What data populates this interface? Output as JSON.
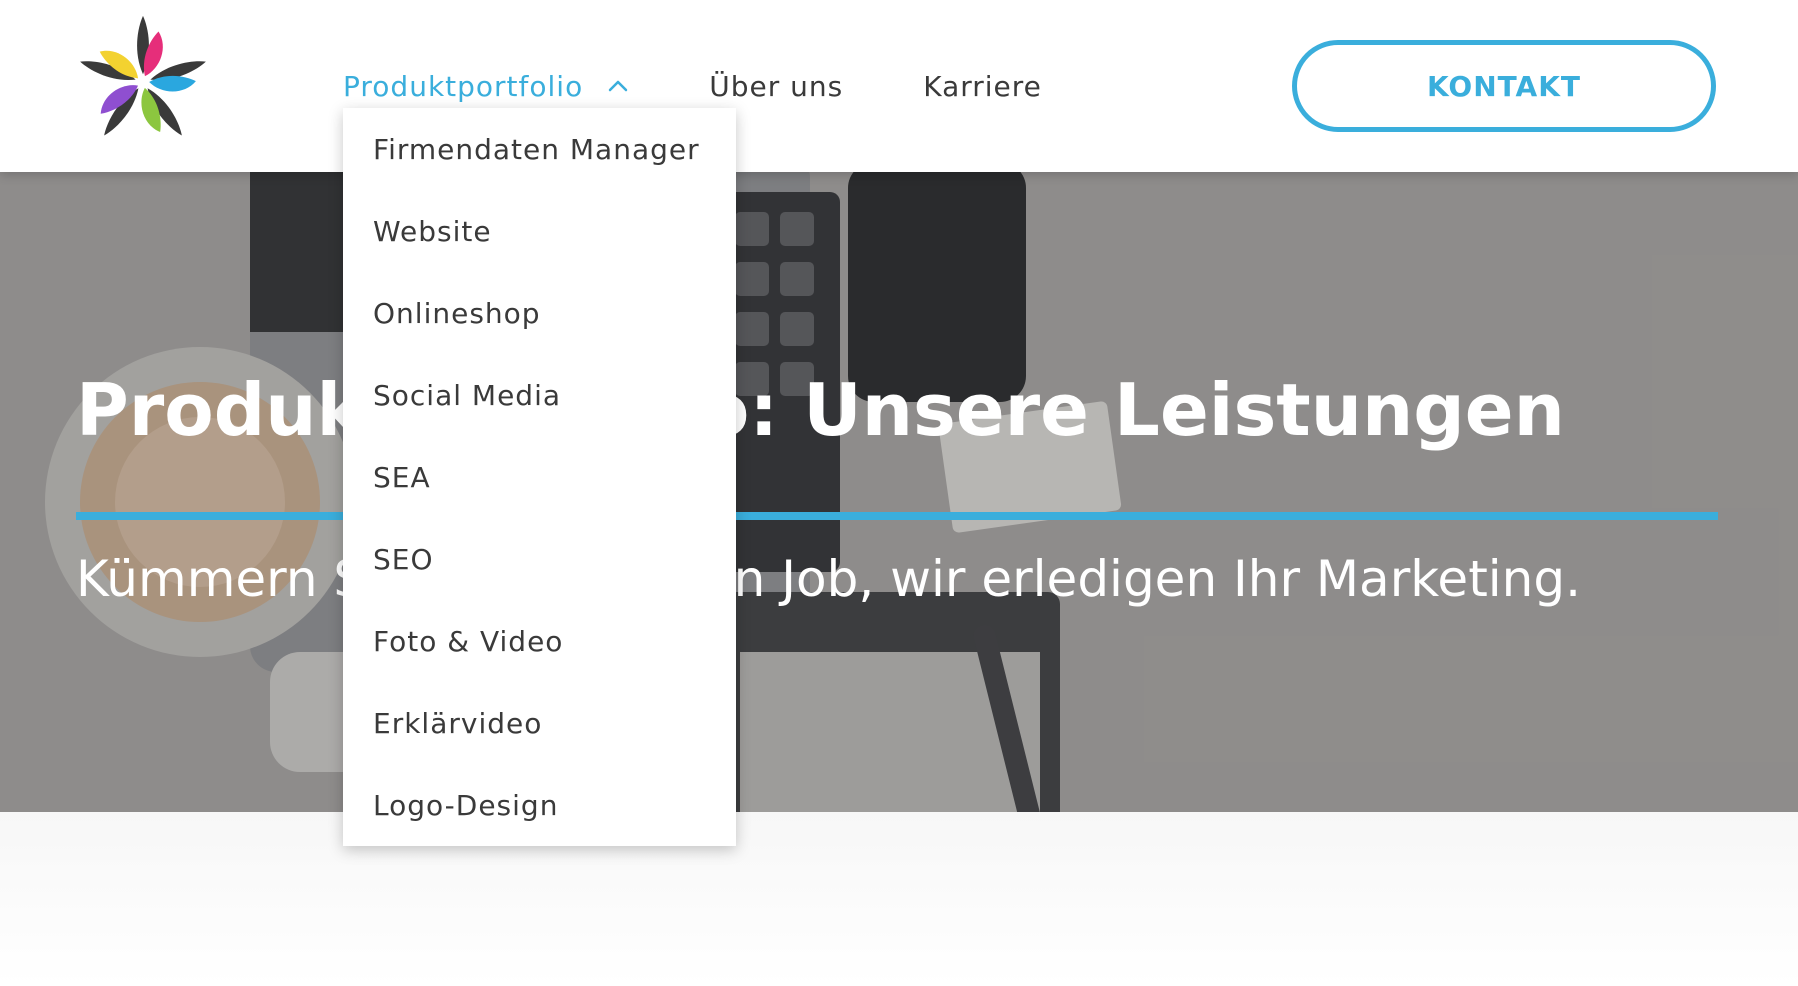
{
  "header": {
    "logo_name": "flower-logo",
    "nav": [
      {
        "label": "Produktportfolio",
        "active": true,
        "icon": "chevron-up-icon"
      },
      {
        "label": "Über uns",
        "active": false
      },
      {
        "label": "Karriere",
        "active": false
      }
    ],
    "cta_label": "KONTAKT"
  },
  "dropdown": {
    "items": [
      "Firmendaten Manager",
      "Website",
      "Onlineshop",
      "Social Media",
      "SEA",
      "SEO",
      "Foto & Video",
      "Erklärvideo",
      "Logo-Design"
    ]
  },
  "hero": {
    "title": "Produktportfolio: Unsere Leistungen",
    "subtitle": "Kümmern Sie sich um Ihren Job, wir erledigen Ihr Marketing."
  },
  "colors": {
    "accent": "#3aaedc",
    "text": "#3a3a3a",
    "hero_text": "#ffffff",
    "logo_petals": [
      "#e62e7a",
      "#2aa7df",
      "#8cc63f",
      "#8f4fd0",
      "#f3d230",
      "#3a3a3a"
    ]
  }
}
